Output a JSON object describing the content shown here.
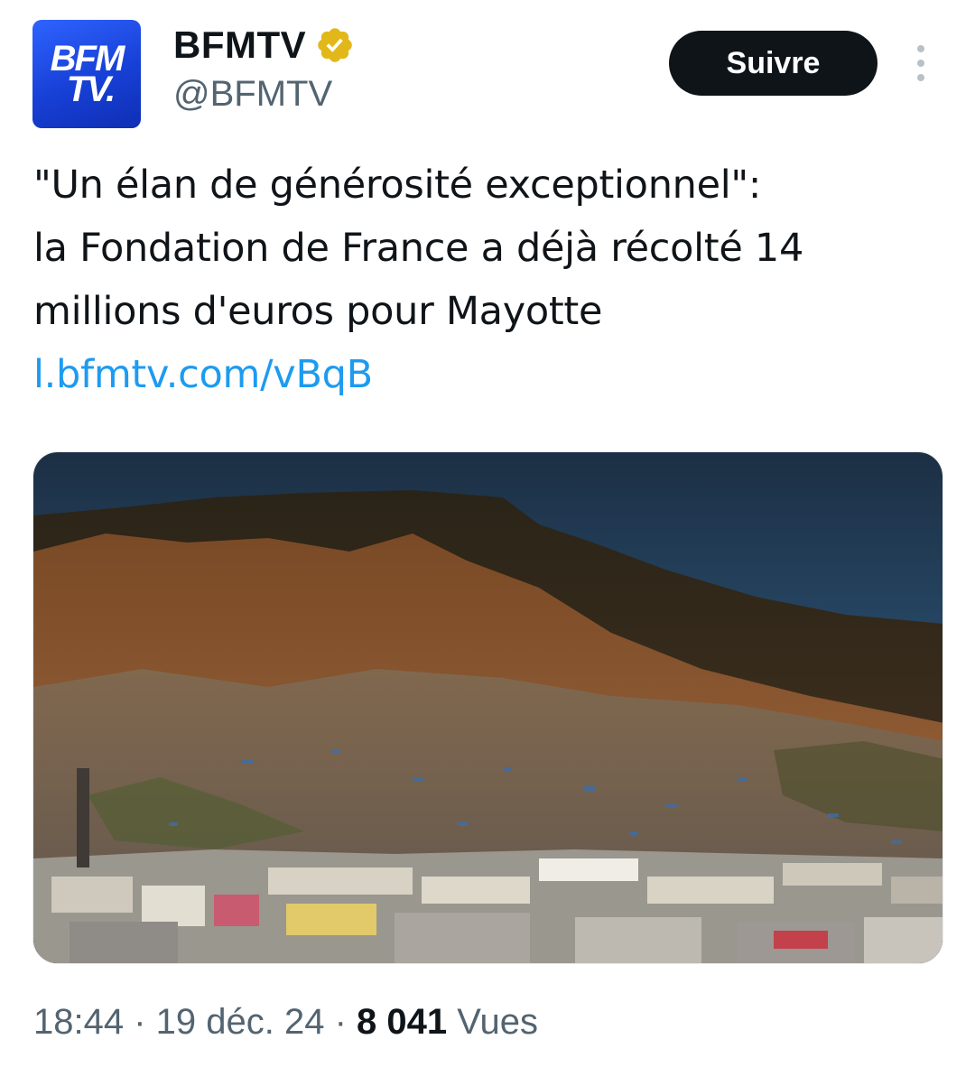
{
  "author": {
    "avatar_line1": "BFM",
    "avatar_line2": "TV.",
    "display_name": "BFMTV",
    "handle": "@BFMTV",
    "verified_badge_color": "#e2b719"
  },
  "actions": {
    "follow_label": "Suivre"
  },
  "tweet": {
    "text_line1": "\"Un élan de générosité exceptionnel\":",
    "text_line2": "la Fondation de France a déjà récolté 14",
    "text_line3": "millions d'euros pour Mayotte",
    "link": "l.bfmtv.com/vBqB"
  },
  "meta": {
    "time": "18:44",
    "sep1": " · ",
    "date": "19 déc. 24",
    "sep2": " · ",
    "views_count": "8 041",
    "views_label": " Vues"
  },
  "icons": {
    "verified": "verified-badge-icon",
    "more": "more-options-icon"
  },
  "colors": {
    "link": "#1d9bf0",
    "button_bg": "#0f1419",
    "secondary_text": "#536471",
    "avatar_blue": "#1f4fe8"
  }
}
